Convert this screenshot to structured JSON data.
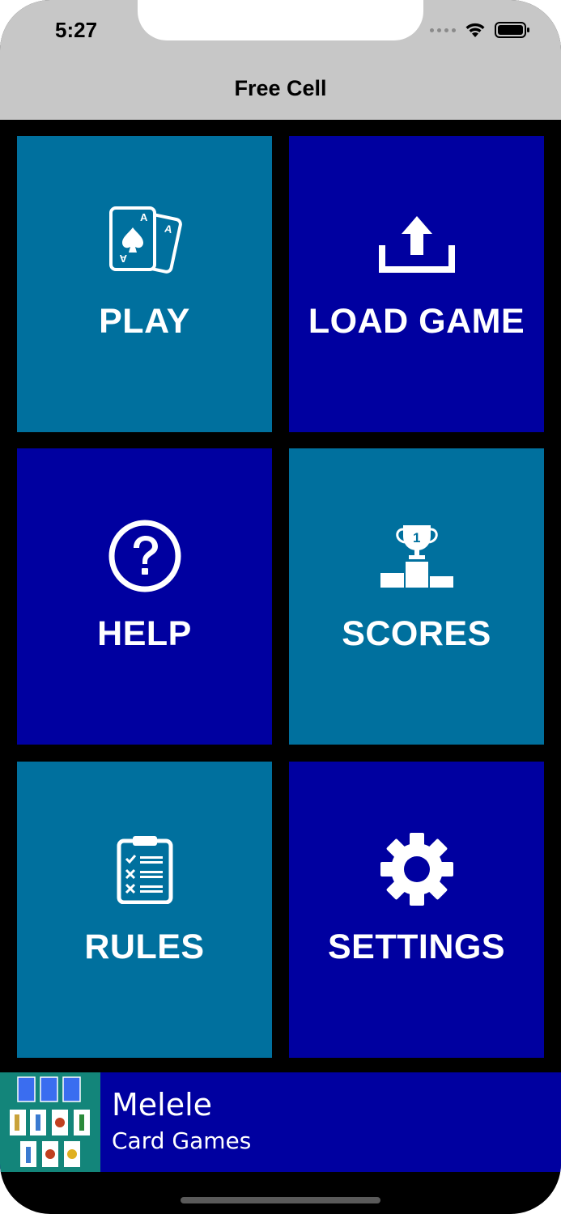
{
  "status_bar": {
    "time": "5:27"
  },
  "nav": {
    "title": "Free Cell"
  },
  "tiles": [
    {
      "label": "PLAY",
      "icon": "cards-icon",
      "color": "#00709e"
    },
    {
      "label": "LOAD GAME",
      "icon": "upload-icon",
      "color": "#0000a0"
    },
    {
      "label": "HELP",
      "icon": "question-icon",
      "color": "#0000a0"
    },
    {
      "label": "SCORES",
      "icon": "trophy-podium-icon",
      "color": "#00709e"
    },
    {
      "label": "RULES",
      "icon": "clipboard-checklist-icon",
      "color": "#00709e"
    },
    {
      "label": "SETTINGS",
      "icon": "gear-icon",
      "color": "#0000a0"
    }
  ],
  "ad": {
    "title": "Melele",
    "subtitle": "Card Games"
  },
  "colors": {
    "teal": "#00709e",
    "navy": "#0000a0",
    "nav_bg": "#c7c7c7",
    "ad_thumb": "#13857a"
  }
}
